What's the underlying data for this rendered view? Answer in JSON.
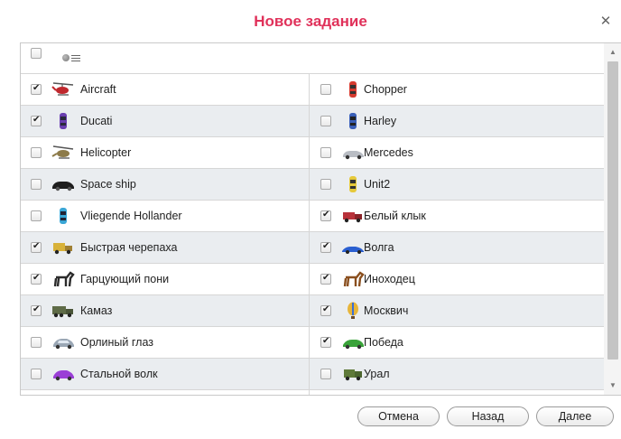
{
  "dialog": {
    "title": "Новое задание",
    "close_icon": "close-icon"
  },
  "header": {
    "select_all_checked": false,
    "icons": [
      "radio-dot-icon",
      "list-lines-icon"
    ]
  },
  "rows": [
    {
      "left": {
        "label": "Aircraft",
        "checked": true,
        "icon": "helicopter-icon"
      },
      "right": {
        "label": "Chopper",
        "checked": false,
        "icon": "red-car-icon"
      }
    },
    {
      "left": {
        "label": "Ducati",
        "checked": true,
        "icon": "purple-car-icon"
      },
      "right": {
        "label": "Harley",
        "checked": false,
        "icon": "blue-car-icon"
      }
    },
    {
      "left": {
        "label": "Helicopter",
        "checked": false,
        "icon": "helicopter-camo-icon"
      },
      "right": {
        "label": "Mercedes",
        "checked": false,
        "icon": "silver-car-icon"
      }
    },
    {
      "left": {
        "label": "Space ship",
        "checked": false,
        "icon": "black-car-icon"
      },
      "right": {
        "label": "Unit2",
        "checked": false,
        "icon": "yellow-car-icon"
      }
    },
    {
      "left": {
        "label": "Vliegende Hollander",
        "checked": false,
        "icon": "cyan-car-icon"
      },
      "right": {
        "label": "Белый клык",
        "checked": true,
        "icon": "red-truck-icon"
      }
    },
    {
      "left": {
        "label": "Быстрая черепаха",
        "checked": true,
        "icon": "yellow-truck-icon"
      },
      "right": {
        "label": "Волга",
        "checked": true,
        "icon": "blue-sports-car-icon"
      }
    },
    {
      "left": {
        "label": "Гарцующий пони",
        "checked": true,
        "icon": "black-horse-icon"
      },
      "right": {
        "label": "Иноходец",
        "checked": true,
        "icon": "brown-horse-icon"
      }
    },
    {
      "left": {
        "label": "Камаз",
        "checked": true,
        "icon": "military-truck-icon"
      },
      "right": {
        "label": "Москвич",
        "checked": true,
        "icon": "balloon-icon"
      }
    },
    {
      "left": {
        "label": "Орлиный глаз",
        "checked": false,
        "icon": "silver-coupe-icon"
      },
      "right": {
        "label": "Победа",
        "checked": true,
        "icon": "green-car-icon"
      }
    },
    {
      "left": {
        "label": "Стальной волк",
        "checked": false,
        "icon": "purple-coupe-icon"
      },
      "right": {
        "label": "Урал",
        "checked": false,
        "icon": "green-truck-icon"
      }
    }
  ],
  "buttons": {
    "cancel": "Отмена",
    "back": "Назад",
    "next": "Далее"
  }
}
